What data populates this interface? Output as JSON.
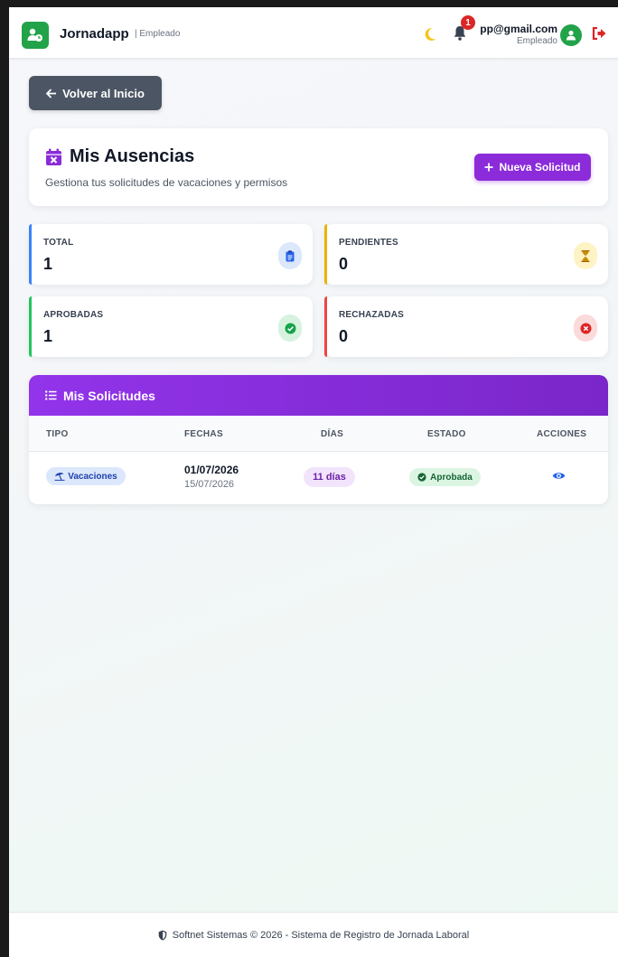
{
  "navbar": {
    "brand": "Jornadapp",
    "role_tag": "| Empleado",
    "notification_count": "1",
    "user_email": "pp@gmail.com",
    "user_role": "Empleado",
    "icons": [
      "user-clock-icon",
      "moon-icon",
      "bell-icon",
      "user-icon",
      "logout-icon"
    ]
  },
  "back_button": {
    "label": "Volver al Inicio",
    "icon": "arrow-left-icon"
  },
  "header": {
    "title": "Mis Ausencias",
    "subtitle": "Gestiona tus solicitudes de vacaciones y permisos",
    "new_button": "Nueva Solicitud",
    "icons": [
      "calendar-x-icon",
      "plus-icon"
    ]
  },
  "stats": [
    {
      "label": "TOTAL",
      "value": "1",
      "color": "#3b82f6",
      "icon": "clipboard-icon"
    },
    {
      "label": "PENDIENTES",
      "value": "0",
      "color": "#eab308",
      "icon": "hourglass-icon"
    },
    {
      "label": "APROBADAS",
      "value": "1",
      "color": "#22c55e",
      "icon": "check-circle-icon"
    },
    {
      "label": "RECHAZADAS",
      "value": "0",
      "color": "#ef4444",
      "icon": "x-circle-icon"
    }
  ],
  "table": {
    "title": "Mis Solicitudes",
    "columns": [
      "TIPO",
      "FECHAS",
      "DÍAS",
      "ESTADO",
      "ACCIONES"
    ],
    "rows": [
      {
        "tipo": "Vacaciones",
        "fecha_inicio": "01/07/2026",
        "fecha_fin": "15/07/2026",
        "dias": "11 días",
        "estado": "Aprobada",
        "accion_icon": "eye-icon"
      }
    ]
  },
  "footer": {
    "text": "Softnet Sistemas © 2026 - Sistema de Registro de Jornada Laboral",
    "icon": "shield-icon"
  },
  "colors": {
    "primary": "#8b2bd9",
    "success": "#22a34a",
    "danger": "#dc2626",
    "secondary": "#4b5563"
  }
}
